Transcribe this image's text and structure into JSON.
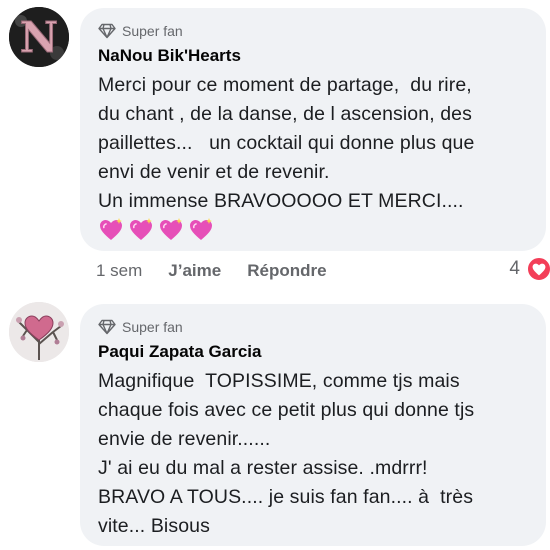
{
  "comments": [
    {
      "badge": "Super fan",
      "author": "NaNou Bik'Hearts",
      "text": "Merci pour ce moment de partage,  du rire,\ndu chant , de la danse, de l ascension, des\npaillettes...   un cocktail qui donne plus que\nenvi de venir et de revenir.\nUn immense BRAVOOOOO ET MERCI....",
      "emoji_count": 4,
      "emoji_icon": "sparkling-heart-icon",
      "time": "1 sem",
      "like_label": "J’aime",
      "reply_label": "Répondre",
      "reaction_count": "4",
      "reaction_icon": "heart-reaction-icon"
    },
    {
      "badge": "Super fan",
      "author": "Paqui Zapata Garcia",
      "text": "Magnifique  TOPISSIME, comme tjs mais\nchaque fois avec ce petit plus qui donne tjs\nenvie de revenir......\nJ' ai eu du mal a rester assise. .mdrrr!\nBRAVO A TOUS.... je suis fan fan.... à  très\nvite... Bisous"
    }
  ],
  "colors": {
    "bubble": "#f0f2f5",
    "author_text": "#050505",
    "meta_text": "#65676b",
    "reaction_heart": "#f33e58",
    "emoji_heart": "#e64fb8"
  }
}
